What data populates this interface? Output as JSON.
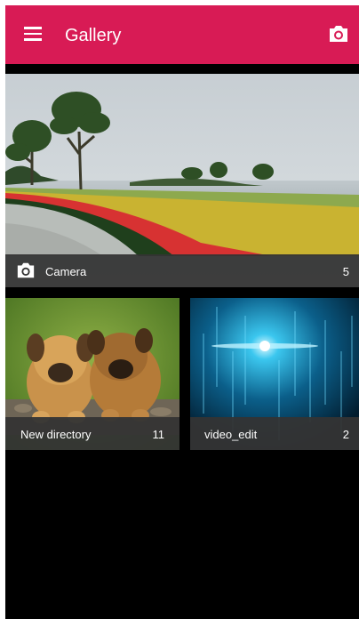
{
  "appbar": {
    "title": "Gallery",
    "menu_icon": "menu-icon",
    "action_icon": "camera-icon",
    "color": "#d81b55"
  },
  "albums": [
    {
      "name": "Camera",
      "count": "5",
      "icon": "camera-icon"
    },
    {
      "name": "New directory",
      "count": "11"
    },
    {
      "name": "video_edit",
      "count": "2"
    }
  ]
}
